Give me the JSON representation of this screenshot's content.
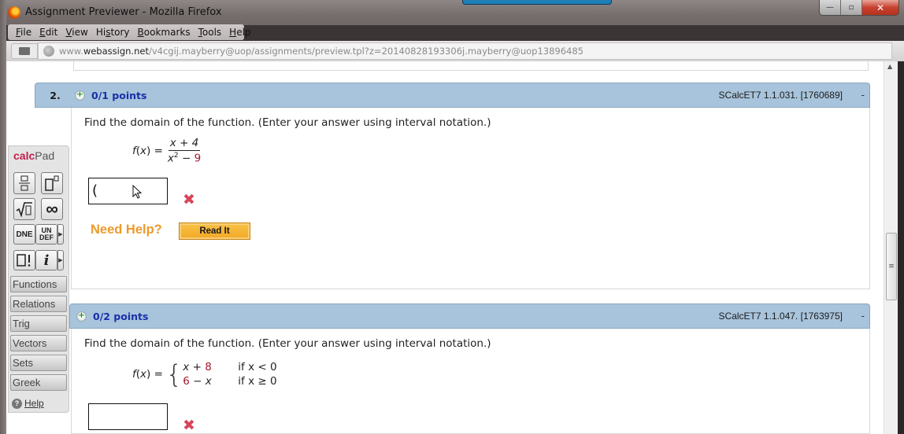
{
  "window": {
    "title": "Assignment Previewer - Mozilla Firefox",
    "controls": {
      "minimize": "—",
      "maximize": "▫",
      "close": "✕"
    }
  },
  "menubar": {
    "items": [
      {
        "label": "File",
        "accesskey": "F"
      },
      {
        "label": "Edit",
        "accesskey": "E"
      },
      {
        "label": "View",
        "accesskey": "V"
      },
      {
        "label": "History",
        "accesskey": "s"
      },
      {
        "label": "Bookmarks",
        "accesskey": "B"
      },
      {
        "label": "Tools",
        "accesskey": "T"
      },
      {
        "label": "Help",
        "accesskey": "H"
      }
    ]
  },
  "address": {
    "prefix": "www.",
    "domain": "webassign.net",
    "path": "/v4cgij.mayberry@uop/assignments/preview.tpl?z=20140828193306j.mayberry@uop13896485"
  },
  "calcpad": {
    "title_a": "calc",
    "title_b": "Pad",
    "buttons": [
      {
        "name": "fraction",
        "glyph": "▭/▭"
      },
      {
        "name": "exponent",
        "glyph": "□ⁿ"
      },
      {
        "name": "sqrt",
        "glyph": "√□"
      },
      {
        "name": "infinity",
        "glyph": "∞"
      },
      {
        "name": "dne",
        "glyph": "DNE"
      },
      {
        "name": "undefined",
        "glyph": "UN DEF"
      },
      {
        "name": "factorial",
        "glyph": "□!"
      },
      {
        "name": "imaginary",
        "glyph": "i"
      }
    ],
    "categories": [
      "Functions",
      "Relations",
      "Trig",
      "Vectors",
      "Sets",
      "Greek"
    ],
    "help_label": "Help"
  },
  "questions": [
    {
      "number": "2.",
      "points": "0/1 points",
      "reference": "SCalcET7 1.1.031. [1760689]",
      "collapse": "-",
      "prompt": "Find the domain of the function. (Enter your answer using interval notation.)",
      "function": {
        "lhs": "f(x) =",
        "numerator": "x + 4",
        "denominator_base": "x",
        "denominator_exp": "2",
        "denominator_rest": " − ",
        "denominator_const": "9"
      },
      "answer_value": "(",
      "status": "incorrect",
      "need_help": "Need Help?",
      "read_it": "Read It"
    },
    {
      "number": "",
      "points": "0/2 points",
      "reference": "SCalcET7 1.1.047. [1763975]",
      "collapse": "-",
      "prompt": "Find the domain of the function. (Enter your answer using interval notation.)",
      "function": {
        "lhs": "f(x) =",
        "cases": [
          {
            "expr_a": "x",
            "op": " + ",
            "expr_b": "8",
            "cond": "if x < 0"
          },
          {
            "expr_a": "6",
            "op": " − ",
            "expr_b": "x",
            "cond": "if x ≥ 0"
          }
        ]
      },
      "answer_value": "",
      "status": "incorrect"
    }
  ]
}
